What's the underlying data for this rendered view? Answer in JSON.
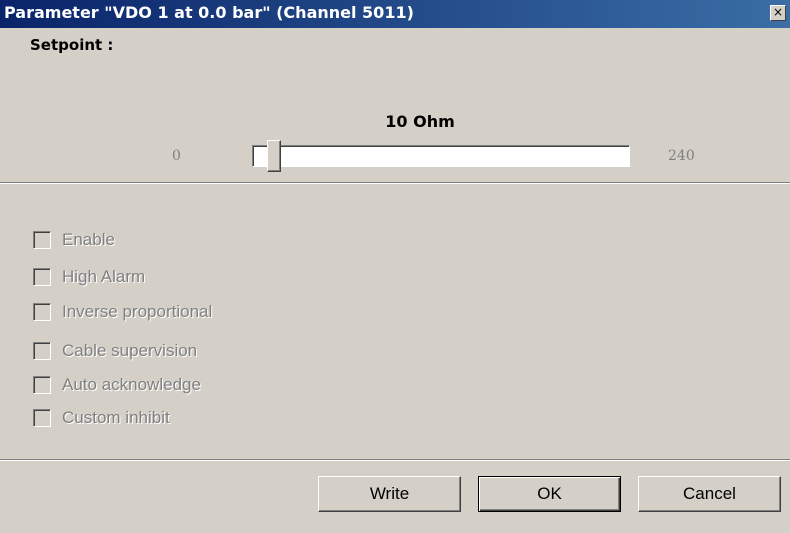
{
  "window": {
    "title": "Parameter \"VDO 1 at  0.0 bar\" (Channel 5011)",
    "close_icon": "close-icon",
    "close_glyph": "×"
  },
  "setpoint": {
    "label": "Setpoint :",
    "value_label": "10 Ohm",
    "value": 10,
    "min": 0,
    "max": 240,
    "min_label": "0",
    "max_label": "240"
  },
  "options": [
    {
      "label": "Enable",
      "checked": false,
      "enabled": false
    },
    {
      "label": "High Alarm",
      "checked": false,
      "enabled": false
    },
    {
      "label": "Inverse proportional",
      "checked": false,
      "enabled": false
    },
    {
      "label": "Cable supervision",
      "checked": false,
      "enabled": false
    },
    {
      "label": "Auto acknowledge",
      "checked": false,
      "enabled": false
    },
    {
      "label": "Custom inhibit",
      "checked": false,
      "enabled": false
    }
  ],
  "buttons": {
    "write": "Write",
    "ok": "OK",
    "cancel": "Cancel"
  }
}
